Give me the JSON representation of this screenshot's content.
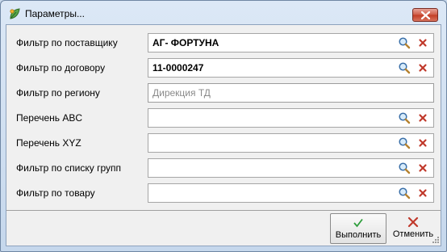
{
  "window": {
    "title": "Параметры..."
  },
  "filters": [
    {
      "label": "Фильтр по поставщику",
      "value": "АГ- ФОРТУНА",
      "placeholder": "",
      "has_buttons": true
    },
    {
      "label": "Фильтр по договору",
      "value": "11-0000247",
      "placeholder": "",
      "has_buttons": true
    },
    {
      "label": "Фильтр по региону",
      "value": "",
      "placeholder": "Дирекция ТД",
      "has_buttons": false
    },
    {
      "label": "Перечень ABC",
      "value": "",
      "placeholder": "",
      "has_buttons": true
    },
    {
      "label": "Перечень XYZ",
      "value": "",
      "placeholder": "",
      "has_buttons": true
    },
    {
      "label": "Фильтр по списку групп",
      "value": "",
      "placeholder": "",
      "has_buttons": true
    },
    {
      "label": "Фильтр по товару",
      "value": "",
      "placeholder": "",
      "has_buttons": true
    }
  ],
  "buttons": {
    "run_label": "Выполнить",
    "cancel_label": "Отменить"
  },
  "icons": {
    "app": "app-leaf-icon",
    "search": "search-icon",
    "clear": "clear-x-icon",
    "run": "check-icon",
    "cancel": "cancel-x-icon",
    "close": "close-icon"
  },
  "colors": {
    "clear_red": "#c0392b",
    "check_green": "#2e9e3c",
    "close_button": "#c9442c"
  }
}
